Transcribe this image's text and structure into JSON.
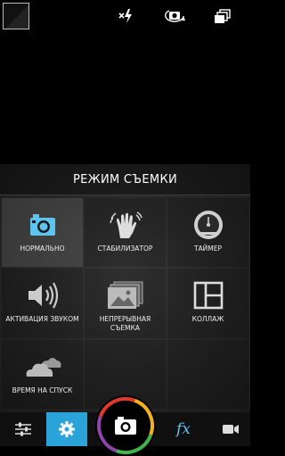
{
  "top_bar": {
    "icons": [
      "gallery-thumbnail",
      "flash-off-icon",
      "switch-camera-icon",
      "copies-icon"
    ]
  },
  "mode_panel": {
    "title": "РЕЖИМ СЪЕМКИ",
    "modes": [
      {
        "label": "НОРМАЛЬНО",
        "icon": "camera-icon",
        "selected": true
      },
      {
        "label": "СТАБИЛИЗАТОР",
        "icon": "shaky-hand-icon",
        "selected": false
      },
      {
        "label": "ТАЙМЕР",
        "icon": "timer-icon",
        "selected": false
      },
      {
        "label": "АКТИВАЦИЯ ЗВУКОМ",
        "icon": "speaker-icon",
        "selected": false
      },
      {
        "label": "НЕПРЕРЫВНАЯ СЪЕМКА",
        "icon": "burst-photos-icon",
        "selected": false
      },
      {
        "label": "КОЛЛАЖ",
        "icon": "collage-icon",
        "selected": false
      },
      {
        "label": "ВРЕМЯ НА СПУСК",
        "icon": "clouds-icon",
        "selected": false
      }
    ]
  },
  "bottom_bar": {
    "items": [
      "adjust-sliders-icon",
      "settings-gear-icon",
      "shutter-camera-icon",
      "fx-label",
      "video-camera-icon"
    ],
    "fx_text": "fx",
    "accent_color": "#2aa3d8"
  }
}
